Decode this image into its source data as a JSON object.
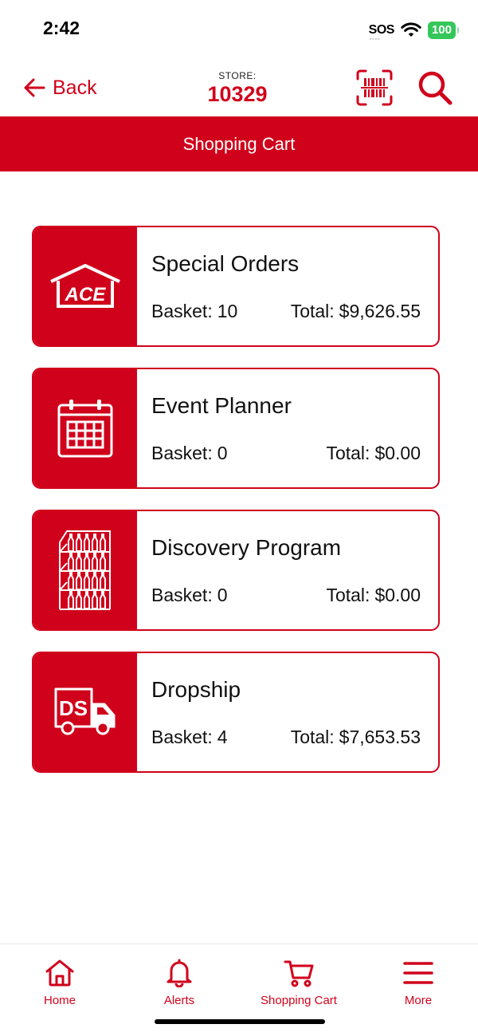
{
  "status_bar": {
    "time": "2:42",
    "sos": "SOS",
    "battery": "100"
  },
  "nav": {
    "back_label": "Back",
    "store_label": "STORE:",
    "store_number": "10329"
  },
  "page_title": "Shopping Cart",
  "cards": [
    {
      "title": "Special Orders",
      "basket_label": "Basket:",
      "basket_value": "10",
      "total_label": "Total:",
      "total_value": "$9,626.55",
      "icon": "ace-house-icon",
      "icon_text": "ACE"
    },
    {
      "title": "Event Planner",
      "basket_label": "Basket:",
      "basket_value": "0",
      "total_label": "Total:",
      "total_value": "$0.00",
      "icon": "calendar-icon"
    },
    {
      "title": "Discovery Program",
      "basket_label": "Basket:",
      "basket_value": "0",
      "total_label": "Total:",
      "total_value": "$0.00",
      "icon": "store-shelf-icon"
    },
    {
      "title": "Dropship",
      "basket_label": "Basket:",
      "basket_value": "4",
      "total_label": "Total:",
      "total_value": "$7,653.53",
      "icon": "delivery-truck-icon",
      "icon_text": "DS"
    }
  ],
  "tabs": [
    {
      "label": "Home",
      "icon": "home-icon"
    },
    {
      "label": "Alerts",
      "icon": "bell-icon"
    },
    {
      "label": "Shopping Cart",
      "icon": "cart-icon"
    },
    {
      "label": "More",
      "icon": "menu-icon"
    }
  ],
  "colors": {
    "brand_red": "#d0021b",
    "battery_green": "#34c759"
  }
}
